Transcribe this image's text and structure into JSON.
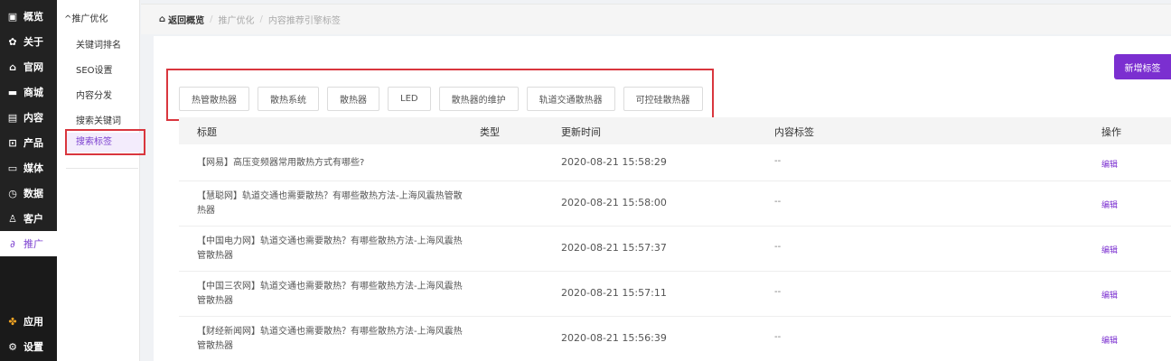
{
  "nav": {
    "items": [
      {
        "icon": "monitor-icon",
        "glyph": "▣",
        "label": "概览"
      },
      {
        "icon": "gear-icon",
        "glyph": "✿",
        "label": "关于"
      },
      {
        "icon": "home-icon",
        "glyph": "⌂",
        "label": "官网"
      },
      {
        "icon": "shop-icon",
        "glyph": "▬",
        "label": "商城"
      },
      {
        "icon": "document-icon",
        "glyph": "▤",
        "label": "内容"
      },
      {
        "icon": "box-icon",
        "glyph": "⊡",
        "label": "产品"
      },
      {
        "icon": "video-icon",
        "glyph": "▭",
        "label": "媒体"
      },
      {
        "icon": "clock-icon",
        "glyph": "◷",
        "label": "数据"
      },
      {
        "icon": "user-icon",
        "glyph": "♙",
        "label": "客户"
      },
      {
        "icon": "paperclip-icon",
        "glyph": "∂",
        "label": "推广"
      }
    ],
    "bottom": [
      {
        "icon": "apps-icon",
        "glyph": "✤",
        "label": "应用"
      },
      {
        "icon": "settings-icon",
        "glyph": "⚙",
        "label": "设置"
      }
    ],
    "active_color": "#7b3fd0"
  },
  "submenu": {
    "head": "推广优化",
    "items": [
      "关键词排名",
      "SEO设置",
      "内容分发",
      "搜索关键词",
      "搜索标签"
    ]
  },
  "breadcrumb": {
    "home": "返回概览",
    "items": [
      "推广优化",
      "内容推荐引擎标签"
    ]
  },
  "add_button": "新增标签",
  "tags": [
    "热管散热器",
    "散热系统",
    "散热器",
    "LED",
    "散热器的维护",
    "轨道交通散热器",
    "可控硅散热器"
  ],
  "table": {
    "headers": [
      "标题",
      "类型",
      "更新时间",
      "内容标签",
      "操作"
    ],
    "rows": [
      {
        "title": "【网易】高压变频器常用散热方式有哪些?",
        "type": "",
        "time": "2020-08-21 15:58:29",
        "tag": "--",
        "op": "编辑"
      },
      {
        "title": "【慧聪网】轨道交通也需要散热？有哪些散热方法-上海风震热管散热器",
        "type": "",
        "time": "2020-08-21 15:58:00",
        "tag": "--",
        "op": "编辑"
      },
      {
        "title": "【中国电力网】轨道交通也需要散热？有哪些散热方法-上海风震热管散热器",
        "type": "",
        "time": "2020-08-21 15:57:37",
        "tag": "--",
        "op": "编辑"
      },
      {
        "title": "【中国三农网】轨道交通也需要散热？有哪些散热方法-上海风震热管散热器",
        "type": "",
        "time": "2020-08-21 15:57:11",
        "tag": "--",
        "op": "编辑"
      },
      {
        "title": "【财经新闻网】轨道交通也需要散热？有哪些散热方法-上海风震热管散热器",
        "type": "",
        "time": "2020-08-21 15:56:39",
        "tag": "--",
        "op": "编辑"
      }
    ]
  },
  "colors": {
    "accent": "#7b2fd0",
    "highlight_box": "#d9363e"
  }
}
